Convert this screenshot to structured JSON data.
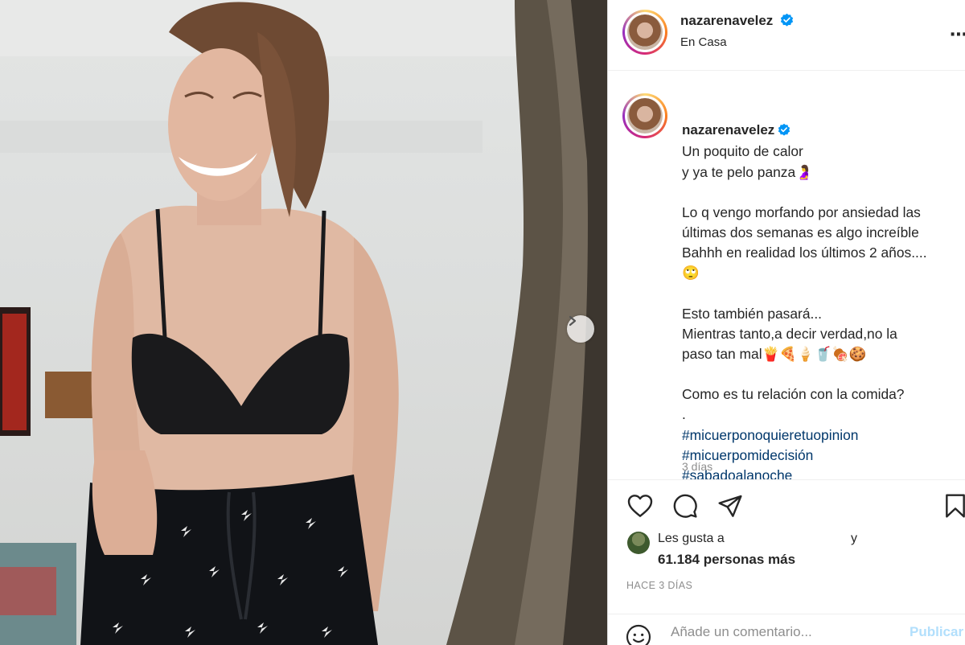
{
  "post": {
    "username": "nazarenavelez",
    "location": "En Casa",
    "caption_lines": [
      "Un poquito de calor\ny ya te pelo panza🤰",
      "Lo q vengo morfando por ansiedad las\núltimas dos semanas es algo increíble\nBahhh en realidad los últimos 2 años....\n🙄",
      "Esto también pasará...\nMientras tanto,a decir verdad,no la\npaso tan mal🍟🍕🍦🥤🍖🍪",
      "Como es tu relación con la comida?\n."
    ],
    "hashtags": [
      "#micuerponoquieretuopinion",
      "#micuerpomidecisión",
      "#sabadoalanoche"
    ],
    "time_ago": "3 días"
  },
  "likes": {
    "prefix": "Les gusta a",
    "connector": "y",
    "count_text": "61.184 personas más"
  },
  "date": "HACE 3 DÍAS",
  "comment": {
    "placeholder": "Añade un comentario...",
    "publish_label": "Publicar"
  },
  "icons": {
    "like": "heart-icon",
    "comment": "comment-icon",
    "share": "share-icon",
    "save": "bookmark-icon",
    "more": "more-icon",
    "next": "chevron-right-icon",
    "verified": "verified-badge-icon",
    "emoji": "emoji-icon"
  },
  "colors": {
    "verified": "#0095f6",
    "hashtag": "#00376b",
    "muted": "#8e8e8e",
    "publish": "#b2dffc"
  }
}
